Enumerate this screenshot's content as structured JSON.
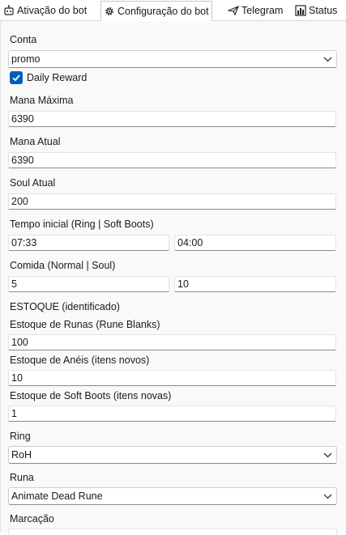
{
  "tabs": [
    {
      "label": "Ativação do bot",
      "icon": "robot-icon"
    },
    {
      "label": "Configuração do bot",
      "icon": "gear-icon",
      "active": true
    },
    {
      "label": "Telegram",
      "icon": "paper-plane-icon"
    },
    {
      "label": "Status",
      "icon": "bar-chart-icon"
    }
  ],
  "form": {
    "conta_label": "Conta",
    "conta_value": "promo",
    "daily_reward_label": "Daily Reward",
    "daily_reward_checked": true,
    "mana_maxima_label": "Mana Máxima",
    "mana_maxima_value": "6390",
    "mana_atual_label": "Mana Atual",
    "mana_atual_value": "6390",
    "soul_atual_label": "Soul Atual",
    "soul_atual_value": "200",
    "tempo_inicial_label": "Tempo inicial (Ring | Soft Boots)",
    "tempo_ring_value": "07:33",
    "tempo_boots_value": "04:00",
    "comida_label": "Comida (Normal | Soul)",
    "comida_normal_value": "5",
    "comida_soul_value": "10",
    "estoque_header": "ESTOQUE (identificado)",
    "estoque_runas_label": "Estoque de Runas (Rune Blanks)",
    "estoque_runas_value": "100",
    "estoque_aneis_label": "Estoque de Anéis (itens novos)",
    "estoque_aneis_value": "10",
    "estoque_boots_label": "Estoque de Soft Boots (itens novas)",
    "estoque_boots_value": "1",
    "ring_label": "Ring",
    "ring_value": "RoH",
    "runa_label": "Runa",
    "runa_value": "Animate Dead Rune",
    "marcacao_label": "Marcação"
  },
  "colors": {
    "accent": "#005fb8",
    "panel_bg": "#f9f9f9",
    "field_bg": "#ffffff"
  }
}
